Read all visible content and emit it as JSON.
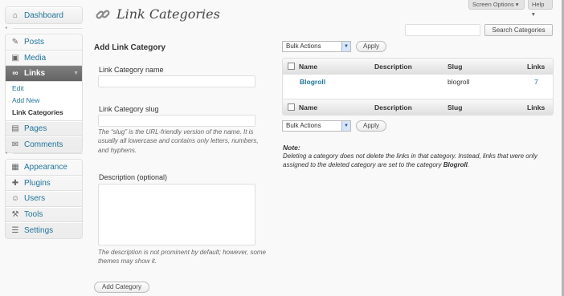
{
  "sidebar": {
    "groups": [
      {
        "items": [
          {
            "label": "Dashboard",
            "icon": "dashboard-icon"
          }
        ]
      },
      {
        "items": [
          {
            "label": "Posts",
            "icon": "pushpin-icon"
          },
          {
            "label": "Media",
            "icon": "media-icon"
          },
          {
            "label": "Links",
            "icon": "link-icon",
            "active": true
          }
        ],
        "submenu": [
          "Edit",
          "Add New",
          "Link Categories"
        ],
        "after": [
          {
            "label": "Pages",
            "icon": "page-icon"
          },
          {
            "label": "Comments",
            "icon": "comment-icon"
          }
        ]
      },
      {
        "items": [
          {
            "label": "Appearance",
            "icon": "appearance-icon"
          },
          {
            "label": "Plugins",
            "icon": "plugin-icon"
          },
          {
            "label": "Users",
            "icon": "users-icon"
          },
          {
            "label": "Tools",
            "icon": "tools-icon"
          },
          {
            "label": "Settings",
            "icon": "settings-icon"
          }
        ]
      }
    ]
  },
  "header": {
    "title": "Link Categories",
    "screen_options": "Screen Options",
    "help": "Help"
  },
  "form": {
    "heading": "Add Link Category",
    "name_label": "Link Category name",
    "name_value": "",
    "slug_label": "Link Category slug",
    "slug_value": "",
    "slug_help": "The “slug” is the URL-friendly version of the name. It is usually all lowercase and contains only letters, numbers, and hyphens.",
    "desc_label": "Description (optional)",
    "desc_value": "",
    "desc_help": "The description is not prominent by default; however, some themes may show it.",
    "submit": "Add Category"
  },
  "search": {
    "value": "",
    "button": "Search Categories"
  },
  "bulk": {
    "top_selected": "Bulk Actions",
    "bottom_selected": "Bulk Actions",
    "apply": "Apply"
  },
  "table": {
    "columns": [
      "Name",
      "Description",
      "Slug",
      "Links"
    ],
    "rows": [
      {
        "name": "Blogroll",
        "description": "",
        "slug": "blogroll",
        "links": "7"
      }
    ]
  },
  "note": {
    "title": "Note:",
    "text_before": "Deleting a category does not delete the links in that category. Instead, links that were only assigned to the deleted category are set to the category ",
    "category": "Blogroll",
    "text_after": "."
  },
  "colors": {
    "link": "#21759b",
    "active_menu": "#6d6d6d"
  }
}
